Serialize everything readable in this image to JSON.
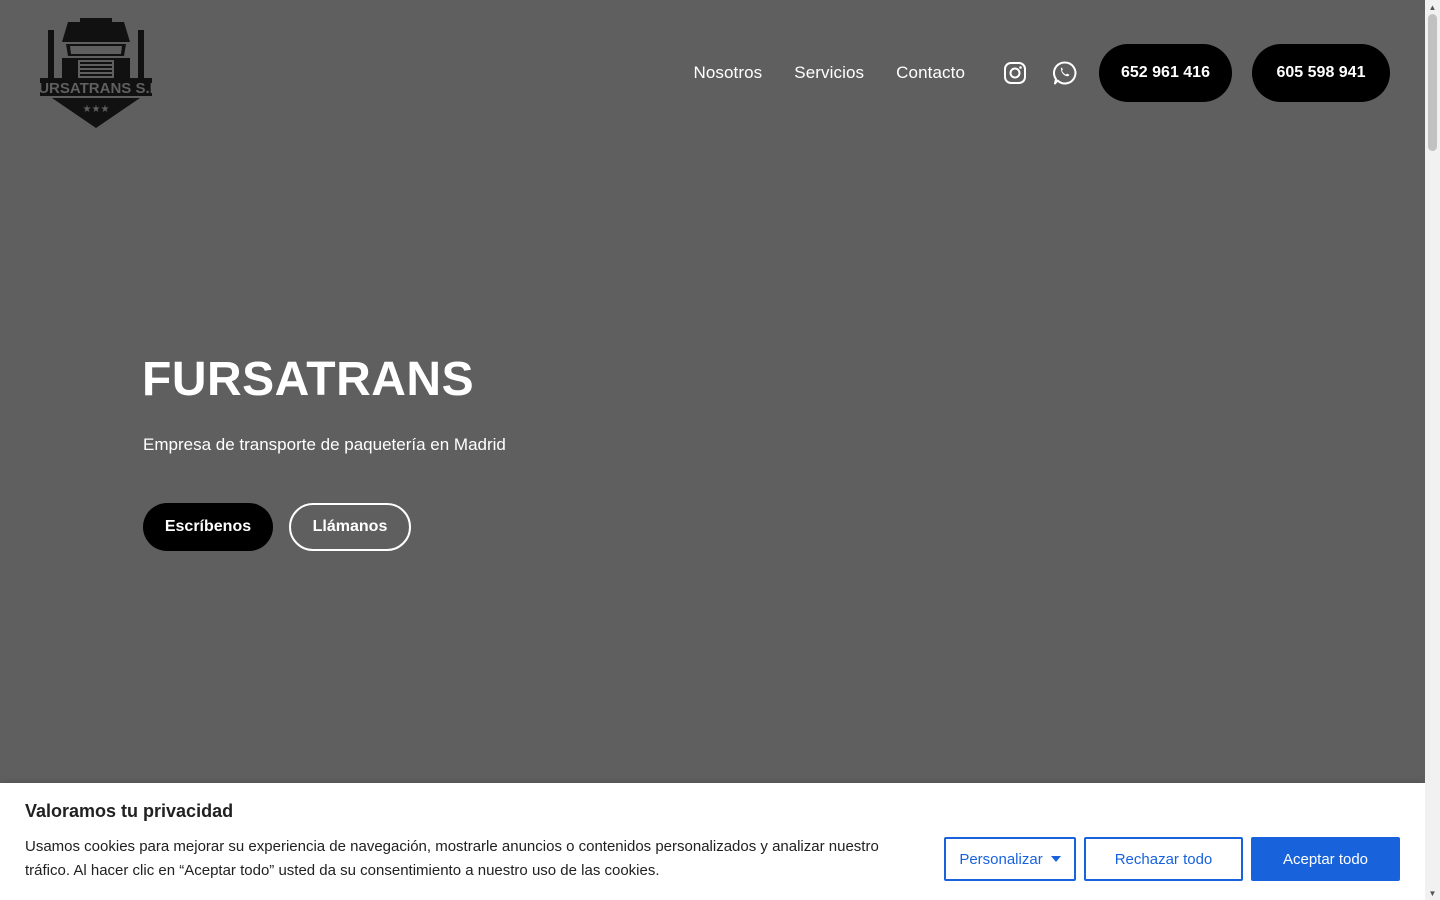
{
  "header": {
    "logo_alt": "FURSATRANS S.L.",
    "nav": [
      "Nosotros",
      "Servicios",
      "Contacto"
    ],
    "social_icons": [
      "instagram-icon",
      "whatsapp-icon"
    ],
    "phones": [
      "652 961 416",
      "605 598 941"
    ]
  },
  "hero": {
    "title": "FURSATRANS",
    "subtitle": "Empresa de transporte de paquetería en Madrid",
    "primary_cta": "Escríbenos",
    "secondary_cta": "Llámanos"
  },
  "cookie_banner": {
    "title": "Valoramos tu privacidad",
    "text": "Usamos cookies para mejorar su experiencia de navegación, mostrarle anuncios o contenidos personalizados y analizar nuestro tráfico. Al hacer clic en “Aceptar todo” usted da su consentimiento a nuestro uso de las cookies.",
    "customize_label": "Personalizar",
    "reject_label": "Rechazar todo",
    "accept_label": "Aceptar todo"
  },
  "colors": {
    "hero_bg": "#5f5f5f",
    "button_dark": "#000000",
    "cookie_accent": "#1863dc"
  }
}
